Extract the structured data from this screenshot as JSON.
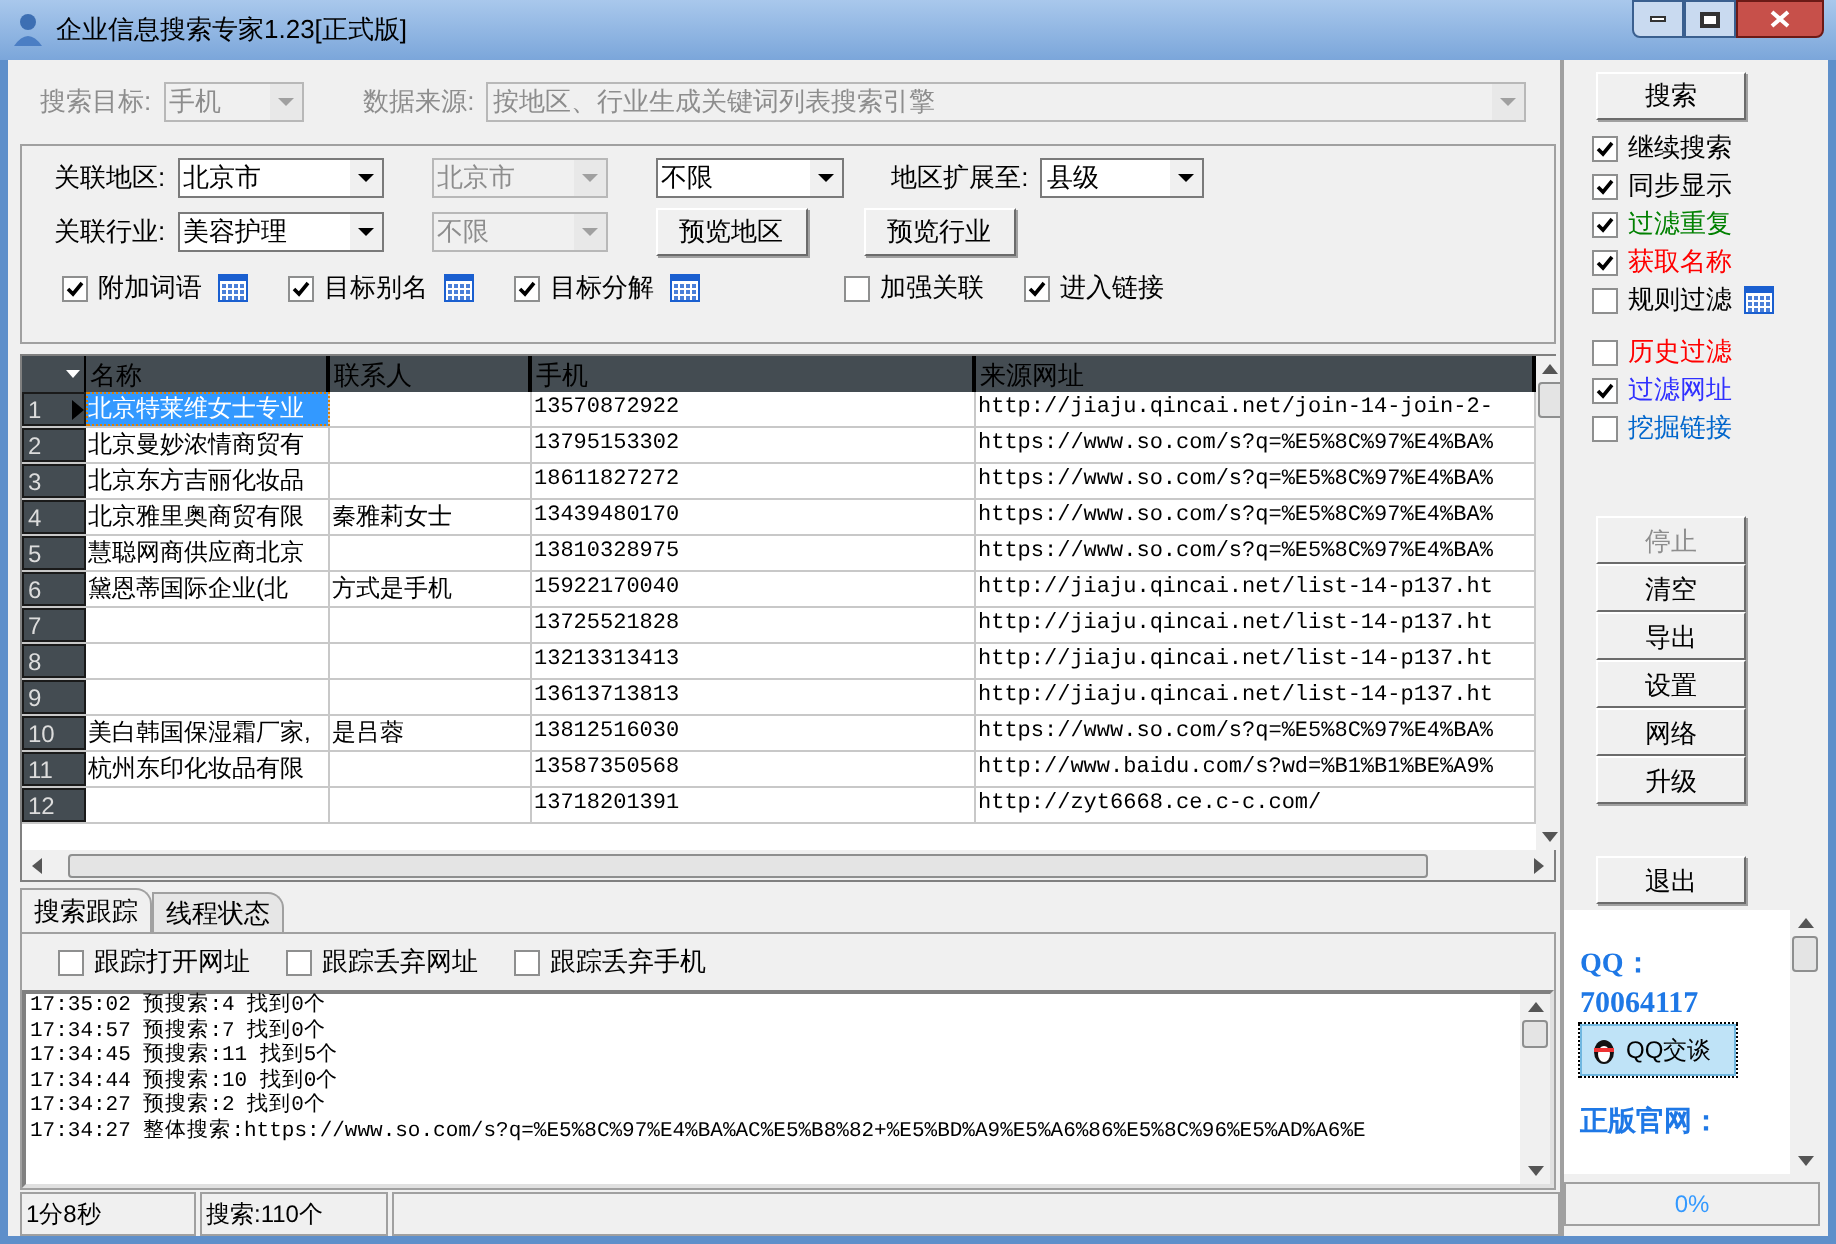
{
  "window": {
    "title": "企业信息搜索专家1.23[正式版]"
  },
  "search_row": {
    "target_label": "搜索目标:",
    "target": {
      "value": "手机",
      "disabled": true
    },
    "source_label": "数据来源:",
    "source": {
      "value": "按地区、行业生成关键词列表搜索引擎",
      "disabled": true
    }
  },
  "filters": {
    "region_label": "关联地区:",
    "region": {
      "value": "北京市",
      "disabled": false
    },
    "region_sub": {
      "value": "北京市",
      "disabled": true
    },
    "region_limit": {
      "value": "不限",
      "disabled": false
    },
    "expand_label": "地区扩展至:",
    "expand": {
      "value": "县级",
      "disabled": false
    },
    "industry_label": "关联行业:",
    "industry": {
      "value": "美容护理",
      "disabled": false
    },
    "industry_sub": {
      "value": "不限",
      "disabled": true
    },
    "preview_region": "预览地区",
    "preview_industry": "预览行业",
    "options": [
      {
        "label": "附加词语",
        "checked": true,
        "calendar": true
      },
      {
        "label": "目标别名",
        "checked": true,
        "calendar": true
      },
      {
        "label": "目标分解",
        "checked": true,
        "calendar": true
      },
      {
        "label": "加强关联",
        "checked": false,
        "calendar": false
      },
      {
        "label": "进入链接",
        "checked": true,
        "calendar": false
      }
    ]
  },
  "table": {
    "columns": [
      "名称",
      "联系人",
      "手机",
      "来源网址"
    ],
    "rows": [
      {
        "number": "1",
        "selected": true,
        "cells": [
          "北京特莱维女士专业",
          "",
          "13570872922",
          "http://jiaju.qincai.net/join-14-join-2-"
        ]
      },
      {
        "number": "2",
        "selected": false,
        "cells": [
          "北京曼妙浓情商贸有",
          "",
          "13795153302",
          "https://www.so.com/s?q=%E5%8C%97%E4%BA%"
        ]
      },
      {
        "number": "3",
        "selected": false,
        "cells": [
          "北京东方吉丽化妆品",
          "",
          "18611827272",
          "https://www.so.com/s?q=%E5%8C%97%E4%BA%"
        ]
      },
      {
        "number": "4",
        "selected": false,
        "cells": [
          "北京雅里奥商贸有限",
          "秦雅莉女士",
          "13439480170",
          "https://www.so.com/s?q=%E5%8C%97%E4%BA%"
        ]
      },
      {
        "number": "5",
        "selected": false,
        "cells": [
          "慧聪网商供应商北京",
          "",
          "13810328975",
          "https://www.so.com/s?q=%E5%8C%97%E4%BA%"
        ]
      },
      {
        "number": "6",
        "selected": false,
        "cells": [
          "黛恩蒂国际企业(北",
          "方式是手机",
          "15922170040",
          "http://jiaju.qincai.net/list-14-p137.ht"
        ]
      },
      {
        "number": "7",
        "selected": false,
        "cells": [
          "",
          "",
          "13725521828",
          "http://jiaju.qincai.net/list-14-p137.ht"
        ]
      },
      {
        "number": "8",
        "selected": false,
        "cells": [
          "",
          "",
          "13213313413",
          "http://jiaju.qincai.net/list-14-p137.ht"
        ]
      },
      {
        "number": "9",
        "selected": false,
        "cells": [
          "",
          "",
          "13613713813",
          "http://jiaju.qincai.net/list-14-p137.ht"
        ]
      },
      {
        "number": "10",
        "selected": false,
        "cells": [
          "美白韩国保湿霜厂家,",
          "是吕蓉",
          "13812516030",
          "https://www.so.com/s?q=%E5%8C%97%E4%BA%"
        ]
      },
      {
        "number": "11",
        "selected": false,
        "cells": [
          "杭州东印化妆品有限",
          "",
          "13587350568",
          "http://www.baidu.com/s?wd=%B1%B1%BE%A9%"
        ]
      },
      {
        "number": "12",
        "selected": false,
        "cells": [
          "",
          "",
          "13718201391",
          "http://zyt6668.ce.c-c.com/"
        ]
      }
    ]
  },
  "tabs": [
    {
      "label": "搜索跟踪",
      "selected": true
    },
    {
      "label": "线程状态",
      "selected": false
    }
  ],
  "trace_options": [
    {
      "label": "跟踪打开网址",
      "checked": false
    },
    {
      "label": "跟踪丢弃网址",
      "checked": false
    },
    {
      "label": "跟踪丢弃手机",
      "checked": false
    }
  ],
  "log": [
    "17:35:02 预搜索:4 找到0个",
    "17:34:57 预搜索:7 找到0个",
    "17:34:45 预搜索:11 找到5个",
    "17:34:44 预搜索:10 找到0个",
    "17:34:27 预搜索:2 找到0个",
    "17:34:27 整体搜索:https://www.so.com/s?q=%E5%8C%97%E4%BA%AC%E5%B8%82+%E5%BD%A9%E5%A6%86%E5%8C%96%E5%AD%A6%E"
  ],
  "status_bar": {
    "elapsed": "1分8秒",
    "count": "搜索:110个",
    "progress": "0%",
    "level": 0
  },
  "side": {
    "search_button": "搜索",
    "options": [
      {
        "label": "继续搜索",
        "checked": true,
        "color": "#000000",
        "calendar": false
      },
      {
        "label": "同步显示",
        "checked": true,
        "color": "#000000",
        "calendar": false
      },
      {
        "label": "过滤重复",
        "checked": true,
        "color": "#008000",
        "calendar": false
      },
      {
        "label": "获取名称",
        "checked": true,
        "color": "#ff0000",
        "calendar": false
      },
      {
        "label": "规则过滤",
        "checked": false,
        "color": "#000000",
        "calendar": true
      }
    ],
    "options2": [
      {
        "label": "历史过滤",
        "checked": false,
        "color": "#ff0000"
      },
      {
        "label": "过滤网址",
        "checked": true,
        "color": "#3030ff"
      },
      {
        "label": "挖掘链接",
        "checked": false,
        "color": "#0066cc"
      }
    ],
    "buttons": [
      {
        "label": "停止",
        "disabled": true
      },
      {
        "label": "清空",
        "disabled": false
      },
      {
        "label": "导出",
        "disabled": false
      },
      {
        "label": "设置",
        "disabled": false
      },
      {
        "label": "网络",
        "disabled": false
      },
      {
        "label": "升级",
        "disabled": false
      }
    ],
    "exit_button": "退出",
    "qq": {
      "label": "QQ：",
      "number": "70064117",
      "chat_button": "QQ交谈",
      "site_label": "正版官网："
    }
  }
}
